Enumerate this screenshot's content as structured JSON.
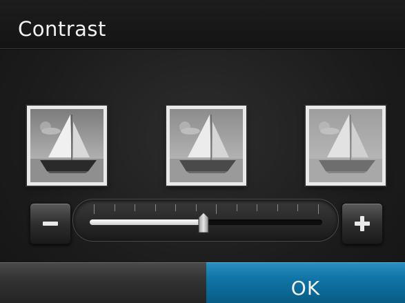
{
  "header": {
    "title": "Contrast"
  },
  "previews": [
    {
      "name": "low-contrast"
    },
    {
      "name": "current-contrast"
    },
    {
      "name": "high-contrast"
    }
  ],
  "slider": {
    "level": 0.49,
    "minus_icon": "minus-icon",
    "plus_icon": "plus-icon",
    "tick_count": 12
  },
  "footer": {
    "ok_label": "OK",
    "left_label": ""
  },
  "colors": {
    "accent": "#0f74a5",
    "background": "#1e1e1e",
    "text": "#f2f2f2"
  }
}
